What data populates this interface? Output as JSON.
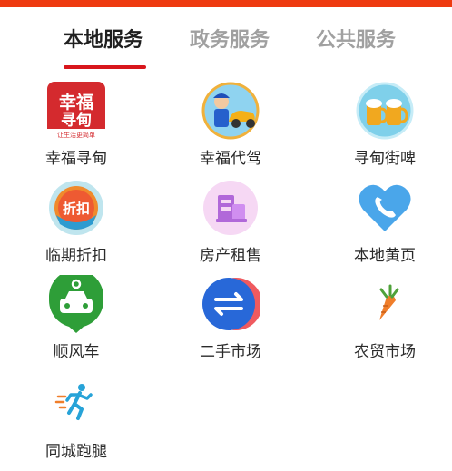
{
  "tabs": [
    {
      "label": "本地服务",
      "active": true
    },
    {
      "label": "政务服务",
      "active": false
    },
    {
      "label": "公共服务",
      "active": false
    }
  ],
  "services": [
    {
      "label": "幸福寻甸",
      "icon": "xingfu-xundian-logo-icon",
      "icon_text": "幸福寻甸",
      "icon_subtext": "让生活更简单"
    },
    {
      "label": "幸福代驾",
      "icon": "chauffeur-car-icon"
    },
    {
      "label": "寻甸街啤",
      "icon": "beer-mugs-icon"
    },
    {
      "label": "临期折扣",
      "icon": "discount-badge-icon",
      "icon_text": "折扣"
    },
    {
      "label": "房产租售",
      "icon": "building-icon"
    },
    {
      "label": "本地黄页",
      "icon": "phone-heart-icon"
    },
    {
      "label": "顺风车",
      "icon": "taxi-pin-icon"
    },
    {
      "label": "二手市场",
      "icon": "swap-arrows-icon"
    },
    {
      "label": "农贸市场",
      "icon": "carrot-icon"
    },
    {
      "label": "同城跑腿",
      "icon": "runner-icon"
    }
  ],
  "colors": {
    "top_bar": "#ee3a10",
    "tab_active": "#1f1f1f",
    "tab_inactive": "#a0a0a0",
    "tab_underline": "#d8161c"
  }
}
